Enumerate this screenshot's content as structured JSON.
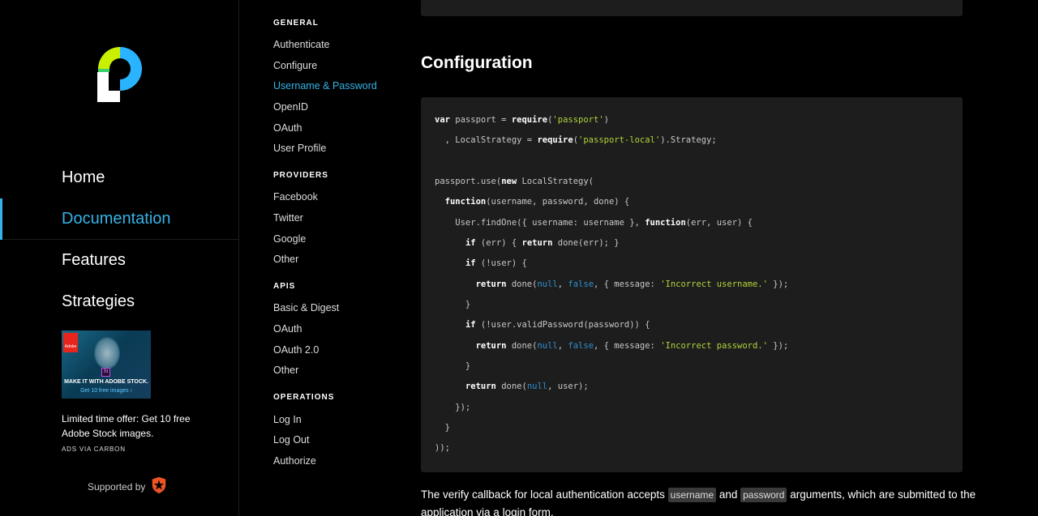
{
  "brand": {
    "logo_name": "passport-logo"
  },
  "main_nav": [
    {
      "label": "Home",
      "active": false
    },
    {
      "label": "Documentation",
      "active": true
    },
    {
      "label": "Features",
      "active": false
    },
    {
      "label": "Strategies",
      "active": false
    }
  ],
  "ad": {
    "image_tagline": "MAKE IT WITH ADOBE STOCK.",
    "image_sub": "Get 10 free images ›",
    "image_brand": "Adobe",
    "image_product": "St",
    "text": "Limited time offer: Get 10 free Adobe Stock images.",
    "via": "ADS VIA CARBON"
  },
  "supported_by": {
    "label": "Supported by",
    "icon": "auth0-icon"
  },
  "subnav": {
    "sections": [
      {
        "title": "GENERAL",
        "links": [
          "Authenticate",
          "Configure",
          "Username & Password",
          "OpenID",
          "OAuth",
          "User Profile"
        ]
      },
      {
        "title": "PROVIDERS",
        "links": [
          "Facebook",
          "Twitter",
          "Google",
          "Other"
        ]
      },
      {
        "title": "APIS",
        "links": [
          "Basic & Digest",
          "OAuth",
          "OAuth 2.0",
          "Other"
        ]
      },
      {
        "title": "OPERATIONS",
        "links": [
          "Log In",
          "Log Out",
          "Authorize"
        ]
      }
    ],
    "active_link": "Username & Password"
  },
  "content": {
    "heading": "Configuration",
    "code_lines": [
      [
        [
          "kw",
          "var"
        ],
        [
          "p",
          " passport = "
        ],
        [
          "kw",
          "require"
        ],
        [
          "p",
          "("
        ],
        [
          "str",
          "'passport'"
        ],
        [
          "p",
          ")"
        ]
      ],
      [
        [
          "p",
          "  , LocalStrategy = "
        ],
        [
          "kw",
          "require"
        ],
        [
          "p",
          "("
        ],
        [
          "str",
          "'passport-local'"
        ],
        [
          "p",
          ").Strategy;"
        ]
      ],
      [
        [
          "p",
          ""
        ]
      ],
      [
        [
          "p",
          "passport.use("
        ],
        [
          "kw",
          "new"
        ],
        [
          "p",
          " LocalStrategy("
        ]
      ],
      [
        [
          "p",
          "  "
        ],
        [
          "kw",
          "function"
        ],
        [
          "p",
          "(username, password, done) {"
        ]
      ],
      [
        [
          "p",
          "    User.findOne({ username: username }, "
        ],
        [
          "kw",
          "function"
        ],
        [
          "p",
          "(err, user) {"
        ]
      ],
      [
        [
          "p",
          "      "
        ],
        [
          "kw",
          "if"
        ],
        [
          "p",
          " (err) { "
        ],
        [
          "kw",
          "return"
        ],
        [
          "p",
          " done(err); }"
        ]
      ],
      [
        [
          "p",
          "      "
        ],
        [
          "kw",
          "if"
        ],
        [
          "p",
          " (!user) {"
        ]
      ],
      [
        [
          "p",
          "        "
        ],
        [
          "kw",
          "return"
        ],
        [
          "p",
          " done("
        ],
        [
          "lit",
          "null"
        ],
        [
          "p",
          ", "
        ],
        [
          "lit",
          "false"
        ],
        [
          "p",
          ", { message: "
        ],
        [
          "str",
          "'Incorrect username.'"
        ],
        [
          "p",
          " });"
        ]
      ],
      [
        [
          "p",
          "      }"
        ]
      ],
      [
        [
          "p",
          "      "
        ],
        [
          "kw",
          "if"
        ],
        [
          "p",
          " (!user.validPassword(password)) {"
        ]
      ],
      [
        [
          "p",
          "        "
        ],
        [
          "kw",
          "return"
        ],
        [
          "p",
          " done("
        ],
        [
          "lit",
          "null"
        ],
        [
          "p",
          ", "
        ],
        [
          "lit",
          "false"
        ],
        [
          "p",
          ", { message: "
        ],
        [
          "str",
          "'Incorrect password.'"
        ],
        [
          "p",
          " });"
        ]
      ],
      [
        [
          "p",
          "      }"
        ]
      ],
      [
        [
          "p",
          "      "
        ],
        [
          "kw",
          "return"
        ],
        [
          "p",
          " done("
        ],
        [
          "lit",
          "null"
        ],
        [
          "p",
          ", user);"
        ]
      ],
      [
        [
          "p",
          "    });"
        ]
      ],
      [
        [
          "p",
          "  }"
        ]
      ],
      [
        [
          "p",
          "));"
        ]
      ]
    ],
    "paragraph": {
      "before": "The verify callback for local authentication accepts",
      "code1": "username",
      "and": "and",
      "code2": "password",
      "after": "arguments, which are submitted to the application via a login form."
    }
  },
  "colors": {
    "accent": "#35b3e8",
    "code_bg": "#1d1d1d",
    "string": "#b0d33a",
    "literal": "#2f8fd0"
  }
}
